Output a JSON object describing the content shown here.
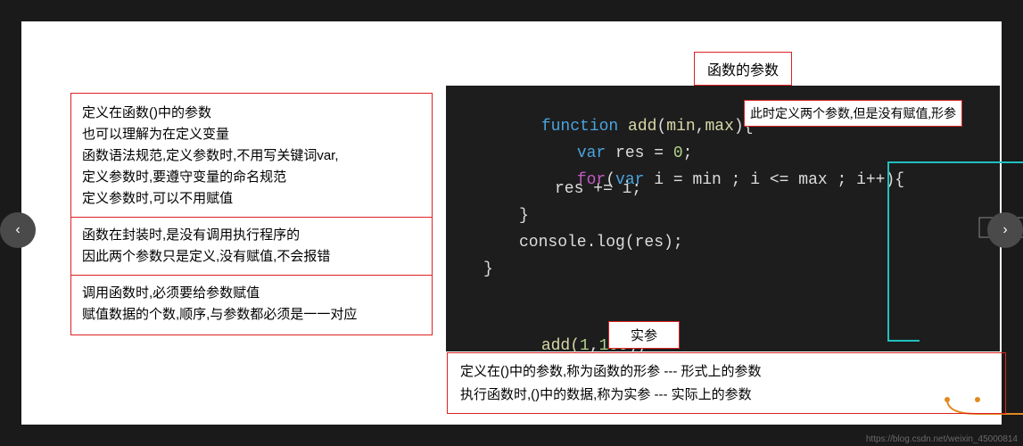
{
  "nav": {
    "prev": "‹",
    "next": "›"
  },
  "watermark": "https://blog.csdn.net/weixin_45000814",
  "label_top": "函数的参数",
  "explain": {
    "p1_l1": "定义在函数()中的参数",
    "p1_l2": "也可以理解为在定义变量",
    "p1_l3": "函数语法规范,定义参数时,不用写关键词var,",
    "p1_l4": "定义参数时,要遵守变量的命名规范",
    "p1_l5": "定义参数时,可以不用赋值",
    "p2_l1": "函数在封装时,是没有调用执行程序的",
    "p2_l2": "因此两个参数只是定义,没有赋值,不会报错",
    "p3_l1": "调用函数时,必须要给参数赋值",
    "p3_l2": "赋值数据的个数,顺序,与参数都必须是一一对应"
  },
  "code": {
    "l1_function": "function",
    "l1_add": " add",
    "l1_open": "(",
    "l1_min": "min",
    "l1_comma": ",",
    "l1_max": "max",
    "l1_close": "){",
    "l2_var": "var",
    "l2_rest": " res = ",
    "l2_zero": "0",
    "l2_semi": ";",
    "l3_for": "for",
    "l3_open": "(",
    "l3_var": "var",
    "l3_i": " i = min ; i <= max ; i++",
    "l3_close": "){",
    "l4": "res += i;",
    "l5": "}",
    "l6": "console.log(res);",
    "l7": "}",
    "l8_call": "add(",
    "l8_a": "1",
    "l8_c": ",",
    "l8_b": "100",
    "l8_end": ");"
  },
  "note_inline": "此时定义两个参数,但是没有赋值,形参",
  "note_actual": "实参",
  "bottom": {
    "l1": "定义在()中的参数,称为函数的形参 --- 形式上的参数",
    "l2": "执行函数时,()中的数据,称为实参 --- 实际上的参数"
  }
}
